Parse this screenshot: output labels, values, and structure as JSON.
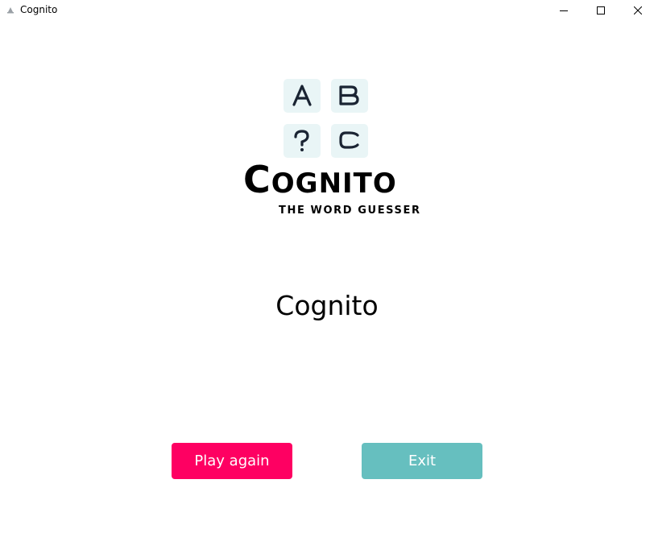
{
  "window": {
    "title": "Cognito",
    "controls": {
      "minimize": "minimize-icon",
      "maximize": "maximize-icon",
      "close": "close-icon"
    }
  },
  "logo": {
    "tiles": [
      "A",
      "B",
      "?",
      "C"
    ],
    "word_initial": "C",
    "word_rest": "OGNITO",
    "tagline": "THE WORD GUESSER",
    "tile_color": "#e9f5f6",
    "letter_color": "#1a2433"
  },
  "heading": "Cognito",
  "buttons": {
    "play_again": "Play again",
    "exit": "Exit"
  },
  "colors": {
    "play_again": "#fe0062",
    "exit": "#66bfbf"
  }
}
